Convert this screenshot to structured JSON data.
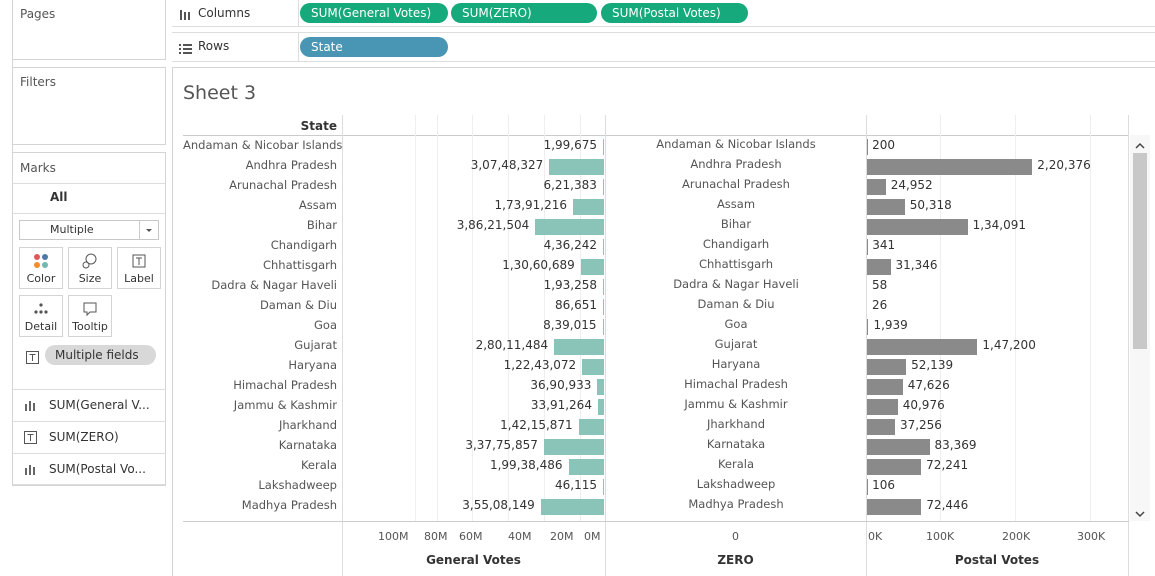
{
  "left_panel": {
    "pages_title": "Pages",
    "filters_title": "Filters",
    "marks_title": "Marks",
    "marks_all": "All",
    "mark_type": "Multiple",
    "cards": {
      "color": "Color",
      "size": "Size",
      "label": "Label",
      "detail": "Detail",
      "tooltip": "Tooltip"
    },
    "multiple_fields_pill": "Multiple fields",
    "marks_rows": [
      "SUM(General V...",
      "SUM(ZERO)",
      "SUM(Postal Vo..."
    ]
  },
  "shelves": {
    "columns_label": "Columns",
    "columns_pills": [
      "SUM(General Votes)",
      "SUM(ZERO)",
      "SUM(Postal Votes)"
    ],
    "rows_label": "Rows",
    "rows_pills": [
      "State"
    ]
  },
  "sheet": {
    "title": "Sheet 3",
    "state_header": "State",
    "axes": {
      "general_votes": {
        "title": "General Votes",
        "ticks": [
          "100M",
          "80M",
          "60M",
          "40M",
          "20M",
          "0M"
        ]
      },
      "zero": {
        "title": "ZERO",
        "ticks": [
          "0"
        ]
      },
      "postal_votes": {
        "title": "Postal Votes",
        "ticks": [
          "0K",
          "100K",
          "200K",
          "300K"
        ]
      }
    },
    "colors": {
      "general_bar": "#8ac3b8",
      "postal_bar": "#8a8a8a",
      "pill_green": "#16a97b",
      "pill_blue": "#4896b3"
    }
  },
  "chart_data": {
    "type": "bar",
    "title": "Sheet 3",
    "categories": [
      "Andaman & Nicobar Islands",
      "Andhra Pradesh",
      "Arunachal Pradesh",
      "Assam",
      "Bihar",
      "Chandigarh",
      "Chhattisgarh",
      "Dadra & Nagar Haveli",
      "Daman & Diu",
      "Goa",
      "Gujarat",
      "Haryana",
      "Himachal Pradesh",
      "Jammu & Kashmir",
      "Jharkhand",
      "Karnataka",
      "Kerala",
      "Lakshadweep",
      "Madhya Pradesh"
    ],
    "series": [
      {
        "name": "General Votes",
        "values": [
          199675,
          30748327,
          621383,
          17391216,
          38621504,
          436242,
          13060689,
          193258,
          86651,
          839015,
          28011484,
          12243072,
          3690933,
          3391264,
          14215871,
          33775857,
          19938486,
          46115,
          35508149
        ],
        "labels": [
          "1,99,675",
          "3,07,48,327",
          "6,21,383",
          "1,73,91,216",
          "3,86,21,504",
          "4,36,242",
          "1,30,60,689",
          "1,93,258",
          "86,651",
          "8,39,015",
          "2,80,11,484",
          "1,22,43,072",
          "36,90,933",
          "33,91,264",
          "1,42,15,871",
          "3,37,75,857",
          "1,99,38,486",
          "46,115",
          "3,55,08,149"
        ]
      },
      {
        "name": "ZERO",
        "values": [
          0,
          0,
          0,
          0,
          0,
          0,
          0,
          0,
          0,
          0,
          0,
          0,
          0,
          0,
          0,
          0,
          0,
          0,
          0
        ]
      },
      {
        "name": "Postal Votes",
        "values": [
          200,
          220376,
          24952,
          50318,
          134091,
          341,
          31346,
          58,
          26,
          1939,
          147200,
          52139,
          47626,
          40976,
          37256,
          83369,
          72241,
          106,
          72446
        ],
        "labels": [
          "200",
          "2,20,376",
          "24,952",
          "50,318",
          "1,34,091",
          "341",
          "31,346",
          "58",
          "26",
          "1,939",
          "1,47,200",
          "52,139",
          "47,626",
          "40,976",
          "37,256",
          "83,369",
          "72,241",
          "106",
          "72,446"
        ]
      }
    ],
    "xlabel": "General Votes / ZERO / Postal Votes",
    "ylabel": "State",
    "general_votes_xlim": [
      0,
      110000000
    ],
    "postal_votes_xlim": [
      0,
      330000
    ],
    "grid": true
  }
}
